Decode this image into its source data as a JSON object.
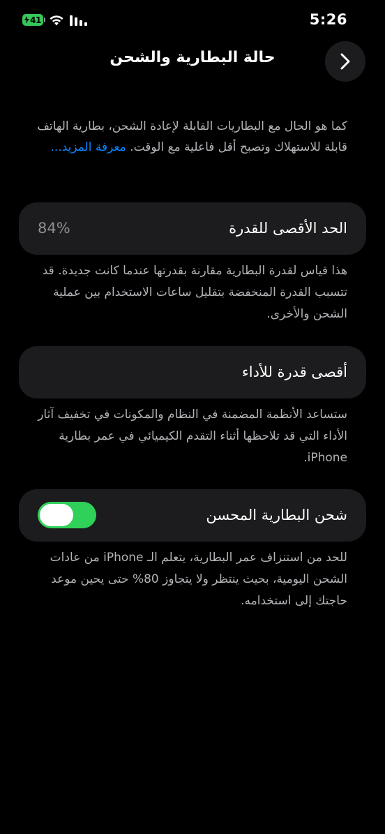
{
  "status_bar": {
    "time": "5:26",
    "battery_level": "41"
  },
  "header": {
    "title": "حالة البطارية والشحن"
  },
  "intro": {
    "text": "كما هو الحال مع البطاريات القابلة لإعادة الشحن، بطارية الهاتف قابلة للاستهلاك وتصبح أقل فاعلية مع الوقت.",
    "learn_more": "معرفة المزيد..."
  },
  "max_capacity": {
    "label": "الحد الأقصى للقدرة",
    "value": "84%",
    "description": "هذا قياس لقدرة البطارية مقارنة بقدرتها عندما كانت جديدة. قد تتسبب القدرة المنخفضة بتقليل ساعات الاستخدام بين عملية الشحن والأخرى."
  },
  "peak_performance": {
    "label": "أقصى قدرة للأداء",
    "description": "ستساعد الأنظمة المضمنة في النظام والمكونات في تخفيف آثار الأداء التي قد تلاحظها أثناء التقدم الكيميائي في عمر بطارية iPhone."
  },
  "optimized_charging": {
    "label": "شحن البطارية المحسن",
    "enabled": true,
    "description": "للحد من استنزاف عمر البطارية، يتعلم الـ iPhone من عادات الشحن اليومية، بحيث ينتظر ولا يتجاوز 80% حتى يحين موعد حاجتك إلى استخدامه."
  },
  "colors": {
    "background": "#000000",
    "card": "#1c1c1e",
    "accent_link": "#0a84ff",
    "toggle_on": "#30d158",
    "battery": "#34c759"
  },
  "icons": {
    "wifi": "wifi-icon",
    "signal": "cellular-signal-icon",
    "back": "chevron-right-icon"
  }
}
